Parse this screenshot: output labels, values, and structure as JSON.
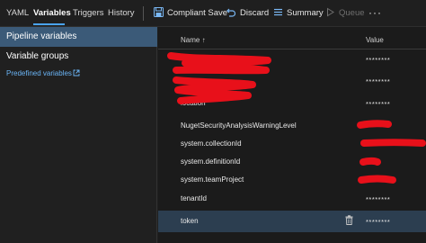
{
  "toolbar": {
    "tabs": [
      {
        "label": "YAML"
      },
      {
        "label": "Variables"
      },
      {
        "label": "Triggers"
      },
      {
        "label": "History"
      }
    ],
    "compliant_save": "Compliant Save",
    "discard": "Discard",
    "summary": "Summary",
    "queue": "Queue",
    "more": "···"
  },
  "sidebar": {
    "items": [
      {
        "label": "Pipeline variables"
      },
      {
        "label": "Variable groups"
      }
    ],
    "predefined_link": "Predefined variables"
  },
  "table": {
    "name_header": "Name",
    "sort_indicator": "↑",
    "value_header": "Value",
    "rows": [
      {
        "name": "",
        "value": "********"
      },
      {
        "name": "",
        "value": "********"
      },
      {
        "name": "location",
        "value": "********"
      },
      {
        "name": "NugetSecurityAnalysisWarningLevel",
        "value": ""
      },
      {
        "name": "system.collectionId",
        "value": ""
      },
      {
        "name": "system.definitionId",
        "value": ""
      },
      {
        "name": "system.teamProject",
        "value": ""
      },
      {
        "name": "tenantId",
        "value": "********"
      },
      {
        "name": "token",
        "value": "********"
      }
    ]
  },
  "colors": {
    "accent": "#4aa3f0",
    "redaction": "#e8101a",
    "selected_nav": "#3b5a78",
    "selected_row": "#2c3e50"
  }
}
